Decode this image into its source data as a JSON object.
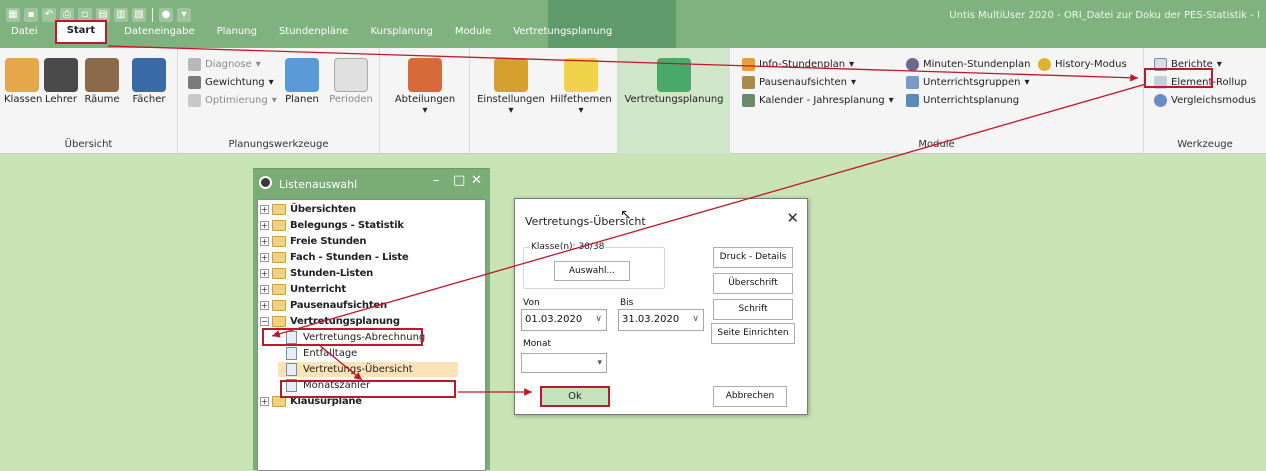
{
  "app": {
    "title": "Untis MultiUser 2020 - ORI_Datei zur Doku der PES-Statistik - I"
  },
  "menu": {
    "tabs": [
      "Datei",
      "Start",
      "Dateneingabe",
      "Planung",
      "Stundenpläne",
      "Kursplanung",
      "Module",
      "Vertretungsplanung"
    ]
  },
  "ribbon": {
    "uebersicht": {
      "label": "Übersicht",
      "buttons": [
        "Klassen",
        "Lehrer",
        "Räume",
        "Fächer"
      ]
    },
    "planung": {
      "label": "Planungswerkzeuge",
      "diagnose": "Diagnose",
      "gewichtung": "Gewichtung",
      "optimierung": "Optimierung",
      "planen": "Planen",
      "perioden": "Perioden"
    },
    "abteilungen": "Abteilungen",
    "einstellungen": "Einstellungen",
    "hilfethemen": "Hilfethemen",
    "vertretungsplanung": "Vertretungsplanung",
    "module": {
      "label": "Module",
      "items": [
        "Info-Stundenplan",
        "Pausenaufsichten",
        "Kalender - Jahresplanung",
        "Minuten-Stundenplan",
        "History-Modus",
        "Unterrichtsgruppen",
        "Unterrichtsplanung"
      ]
    },
    "werkzeuge": {
      "label": "Werkzeuge",
      "items": [
        "Berichte",
        "Element-Rollup",
        "Vergleichsmodus"
      ]
    }
  },
  "listenauswahl": {
    "title": "Listenauswahl",
    "folders": [
      "Übersichten",
      "Belegungs - Statistik",
      "Freie Stunden",
      "Fach - Stunden - Liste",
      "Stunden-Listen",
      "Unterricht",
      "Pausenaufsichten",
      "Vertretungsplanung"
    ],
    "subitems": [
      "Vertretungs-Abrechnung",
      "Entfalltage",
      "Vertretungs-Übersicht",
      "Monatszähler"
    ],
    "last_folder": "Klausurpläne"
  },
  "dialog": {
    "title": "Vertretungs-Übersicht",
    "klassen": "Klasse(n): 38/38",
    "auswahl": "Auswahl...",
    "von_label": "Von",
    "bis_label": "Bis",
    "von": "01.03.2020",
    "bis": "31.03.2020",
    "monat_label": "Monat",
    "buttons": [
      "Druck - Details",
      "Überschrift",
      "Schrift",
      "Seite Einrichten"
    ],
    "ok": "Ok",
    "abbrechen": "Abbrechen"
  },
  "colors": {
    "accent": "#7fb27e",
    "highlight": "#c0182a",
    "canvas": "#c8e3b4"
  }
}
